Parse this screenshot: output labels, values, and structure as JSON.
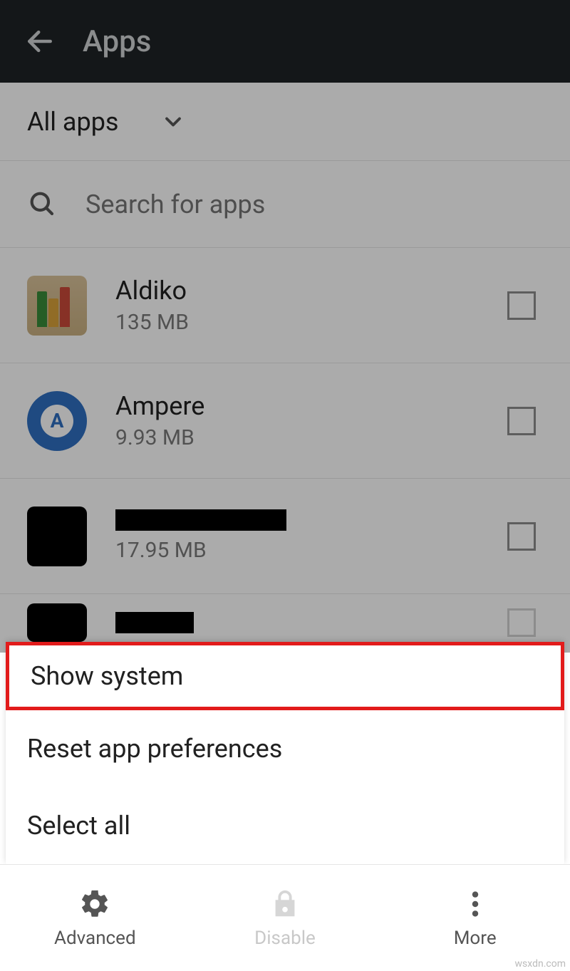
{
  "appbar": {
    "title": "Apps"
  },
  "filter": {
    "label": "All apps"
  },
  "search": {
    "placeholder": "Search for apps"
  },
  "apps": [
    {
      "name": "Aldiko",
      "size": "135 MB"
    },
    {
      "name": "Ampere",
      "size": "9.93 MB"
    },
    {
      "name": "",
      "size": "17.95 MB"
    },
    {
      "name": "",
      "size": ""
    }
  ],
  "menu": {
    "show_system": "Show system",
    "reset": "Reset app preferences",
    "select_all": "Select all"
  },
  "bottomnav": {
    "advanced": "Advanced",
    "disable": "Disable",
    "more": "More"
  },
  "watermark": "wsxdn.com"
}
